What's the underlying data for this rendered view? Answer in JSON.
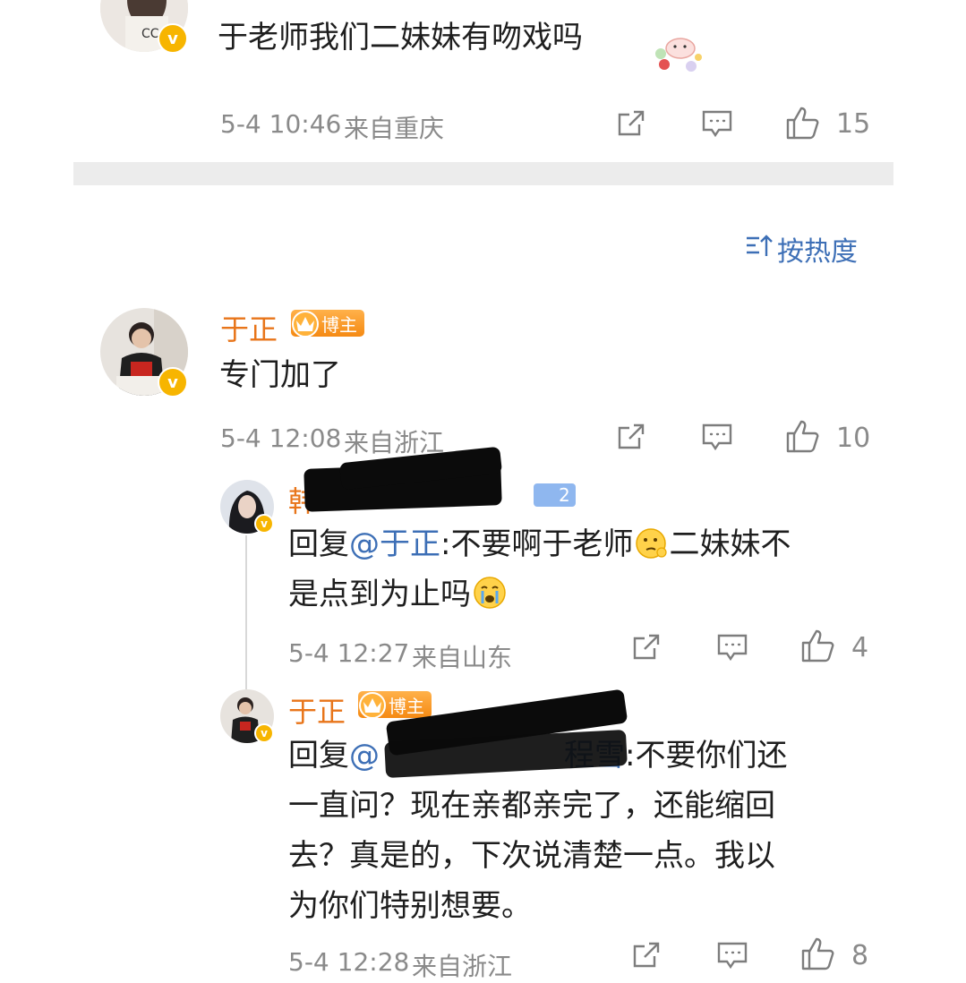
{
  "comment1": {
    "text": "于老师我们二妹妹有吻戏吗",
    "time": "5-4 10:46",
    "location": "来自重庆",
    "likes": "15"
  },
  "sort": {
    "label": "按热度"
  },
  "comment2": {
    "name": "于正",
    "badge": "博主",
    "text": "专门加了",
    "time": "5-4 12:08",
    "location": "来自浙江",
    "likes": "10"
  },
  "reply1": {
    "name_visible": "韩",
    "level_badge": "2",
    "reply_prefix": "回复",
    "mention": "@于正",
    "text_line1": ":不要啊于老师",
    "text_line1b": "二妹妹不",
    "text_line2": "是点到为止吗",
    "time": "5-4 12:27",
    "location": "来自山东",
    "likes": "4"
  },
  "reply2": {
    "name": "于正",
    "badge": "博主",
    "reply_prefix": "回复",
    "mention": "@",
    "mention_tail": "程雪",
    "text_line1": ":不要你们还",
    "text_line2": "一直问？现在亲都亲完了，还能缩回",
    "text_line3": "去？真是的，下次说清楚一点。我以",
    "text_line4": "为你们特别想要。",
    "time": "5-4 12:28",
    "location": "来自浙江",
    "likes": "8"
  },
  "icons": {
    "forward": "share-icon",
    "comment": "comment-icon",
    "like": "thumbs-up-icon",
    "verified": "verified-v-icon"
  },
  "colors": {
    "name": "#e8751a",
    "mention": "#3d6fb6",
    "meta": "#8a8a8a",
    "divider": "#ececec",
    "verified": "#f7b500"
  }
}
